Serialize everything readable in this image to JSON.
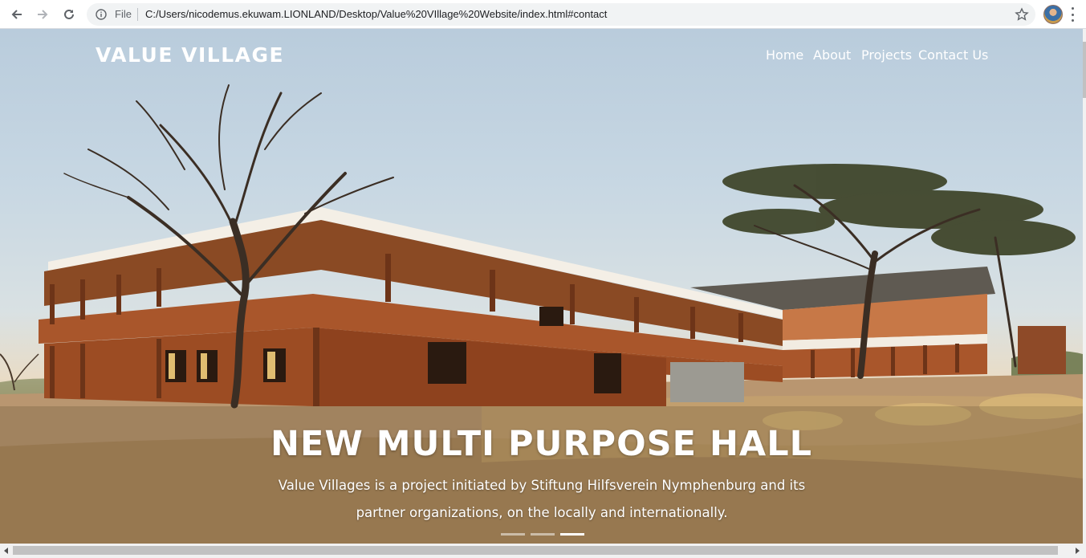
{
  "browser": {
    "file_label": "File",
    "url": "C:/Users/nicodemus.ekuwam.LIONLAND/Desktop/Value%20VIllage%20Website/index.html#contact",
    "icons": [
      "back-icon",
      "forward-icon",
      "reload-icon",
      "info-icon",
      "star-icon",
      "profile-avatar",
      "menu-icon"
    ]
  },
  "site": {
    "brand": "VALUE VILLAGE",
    "nav": {
      "home": "Home",
      "about": "About",
      "projects": "Projects",
      "contact": "Contact Us"
    }
  },
  "hero": {
    "title": "NEW MULTI PURPOSE HALL",
    "text": "Value Villages is a project initiated by Stiftung Hilfsverein Nymphenburg and its partner organizations, on the locally and internationally.",
    "slides_count": 3,
    "active_slide": 3
  },
  "colors": {
    "sky": "#c7d7e3",
    "building": "#a0522d",
    "sand": "#b08b60",
    "text": "#ffffff"
  }
}
